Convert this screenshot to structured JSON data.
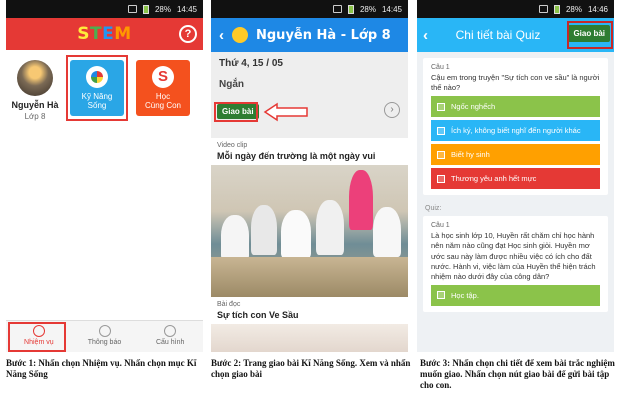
{
  "status": {
    "panel1": {
      "battery": "28%",
      "time": "14:45"
    },
    "panel2": {
      "battery": "28%",
      "time": "14:45"
    },
    "panel3": {
      "battery": "28%",
      "time": "14:46"
    }
  },
  "panel1": {
    "logo": {
      "letters": [
        "S",
        "T",
        "E",
        "M"
      ]
    },
    "profile": {
      "name": "Nguyễn Hà",
      "grade": "Lớp 8"
    },
    "tiles": [
      {
        "label_line1": "Kỹ Năng",
        "label_line2": "Sống",
        "color": "#2aa6e6"
      },
      {
        "label_line1": "Học",
        "label_line2": "Cùng Con",
        "color": "#f4511e",
        "icon_text": "S"
      }
    ],
    "nav": [
      {
        "label": "Nhiệm vụ",
        "icon": "target-icon"
      },
      {
        "label": "Thông báo",
        "icon": "bell-icon"
      },
      {
        "label": "Cấu hình",
        "icon": "gear-icon"
      }
    ]
  },
  "panel2": {
    "title": "Nguyễn Hà - Lớp 8",
    "date": "Thứ 4, 15 / 05",
    "subject": "Ngắn",
    "assign_label": "Giao bài",
    "video_section": "Video clip",
    "video_title": "Mỗi ngày đến trường là một ngày vui",
    "reading_section": "Bài đọc",
    "reading_title": "Sự tích con Ve Sầu"
  },
  "panel3": {
    "title": "Chi tiết bài Quiz",
    "assign_label": "Giao bài",
    "q1": {
      "number": "Câu 1",
      "text": "Cậu em trong truyện \"Sự tích con ve sầu\" là người thế nào?",
      "options": [
        {
          "text": "Ngốc nghếch",
          "color": "#8bc34a"
        },
        {
          "text": "Ích kỷ, không biết nghĩ đến người khác",
          "color": "#29b6f6"
        },
        {
          "text": "Biết hy sinh",
          "color": "#ffa000"
        },
        {
          "text": "Thương yêu anh hết mực",
          "color": "#e53935"
        }
      ]
    },
    "quiz_label": "Quiz:",
    "q2": {
      "number": "Câu 1",
      "text": "Là học sinh lớp 10, Huyền rất chăm chỉ học hành nên năm nào cũng đạt Học sinh giỏi. Huyền mơ ước sau này làm được nhiều việc có ích cho đất nước. Hành vi, việc làm của Huyền thể hiện trách nhiệm nào dưới đây của công dân?",
      "options": [
        {
          "text": "Học tập.",
          "color": "#8bc34a"
        }
      ]
    }
  },
  "captions": [
    "Bước 1: Nhấn chọn Nhiệm vụ. Nhấn chọn mục Kĩ Năng Sống",
    "Bước 2: Trang giao bài Kĩ Năng Sống. Xem và nhấn chọn giao bài",
    "Bước 3: Nhấn chọn chi tiết để xem bài trắc nghiệm muốn giao. Nhấn chọn nút giao bài để gửi bài tập cho con."
  ]
}
